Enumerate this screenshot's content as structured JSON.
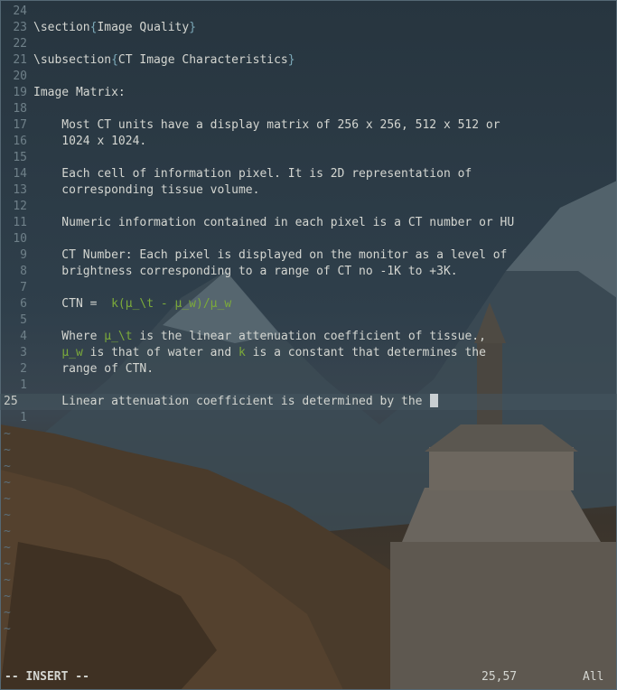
{
  "editor": {
    "lines": [
      {
        "num": "24",
        "parts": []
      },
      {
        "num": "23",
        "parts": [
          {
            "t": "\\section",
            "c": "txt"
          },
          {
            "t": "{",
            "c": "kw"
          },
          {
            "t": "Image Quality",
            "c": "txt"
          },
          {
            "t": "}",
            "c": "kw"
          }
        ]
      },
      {
        "num": "22",
        "parts": []
      },
      {
        "num": "21",
        "parts": [
          {
            "t": "\\subsection",
            "c": "txt"
          },
          {
            "t": "{",
            "c": "kw"
          },
          {
            "t": "CT Image Characteristics",
            "c": "txt"
          },
          {
            "t": "}",
            "c": "kw"
          }
        ]
      },
      {
        "num": "20",
        "parts": []
      },
      {
        "num": "19",
        "parts": [
          {
            "t": "Image Matrix:",
            "c": "txt"
          }
        ]
      },
      {
        "num": "18",
        "parts": []
      },
      {
        "num": "17",
        "parts": [
          {
            "t": "    Most CT units have a display matrix of 256 x 256, 512 x 512 or",
            "c": "txt"
          }
        ]
      },
      {
        "num": "16",
        "parts": [
          {
            "t": "    1024 x 1024.",
            "c": "txt"
          }
        ]
      },
      {
        "num": "15",
        "parts": []
      },
      {
        "num": "14",
        "parts": [
          {
            "t": "    Each cell of information pixel. It is 2D representation of",
            "c": "txt"
          }
        ]
      },
      {
        "num": "13",
        "parts": [
          {
            "t": "    corresponding tissue volume.",
            "c": "txt"
          }
        ]
      },
      {
        "num": "12",
        "parts": []
      },
      {
        "num": "11",
        "parts": [
          {
            "t": "    Numeric information contained in each pixel is a CT number or HU",
            "c": "txt"
          }
        ]
      },
      {
        "num": "10",
        "parts": []
      },
      {
        "num": "9",
        "parts": [
          {
            "t": "    CT Number: Each pixel is displayed on the monitor as a level of",
            "c": "txt"
          }
        ]
      },
      {
        "num": "8",
        "parts": [
          {
            "t": "    brightness corresponding to a range of CT no -1K to +3K.",
            "c": "txt"
          }
        ]
      },
      {
        "num": "7",
        "parts": []
      },
      {
        "num": "6",
        "parts": [
          {
            "t": "    CTN =  ",
            "c": "txt"
          },
          {
            "t": "k(μ_\\t - μ_w)/μ_w",
            "c": "gr"
          }
        ]
      },
      {
        "num": "5",
        "parts": []
      },
      {
        "num": "4",
        "parts": [
          {
            "t": "    Where ",
            "c": "txt"
          },
          {
            "t": "μ_\\t",
            "c": "gr"
          },
          {
            "t": " is the linear attenuation coefficient of tissue.,",
            "c": "txt"
          }
        ]
      },
      {
        "num": "3",
        "parts": [
          {
            "t": "    ",
            "c": "txt"
          },
          {
            "t": "μ_w",
            "c": "gr"
          },
          {
            "t": " is that of water and ",
            "c": "txt"
          },
          {
            "t": "k",
            "c": "gr"
          },
          {
            "t": " is a constant that determines the",
            "c": "txt"
          }
        ]
      },
      {
        "num": "2",
        "parts": [
          {
            "t": "    range of CTN.",
            "c": "txt"
          }
        ]
      },
      {
        "num": "1",
        "parts": []
      },
      {
        "num": "25",
        "current": true,
        "parts": [
          {
            "t": "    Linear attenuation coefficient is determined by the ",
            "c": "txt"
          }
        ]
      },
      {
        "num": "1",
        "parts": []
      }
    ],
    "tilde_count": 13,
    "tilde_char": "~"
  },
  "status": {
    "mode": "-- INSERT --",
    "position": "25,57",
    "scroll": "All"
  }
}
